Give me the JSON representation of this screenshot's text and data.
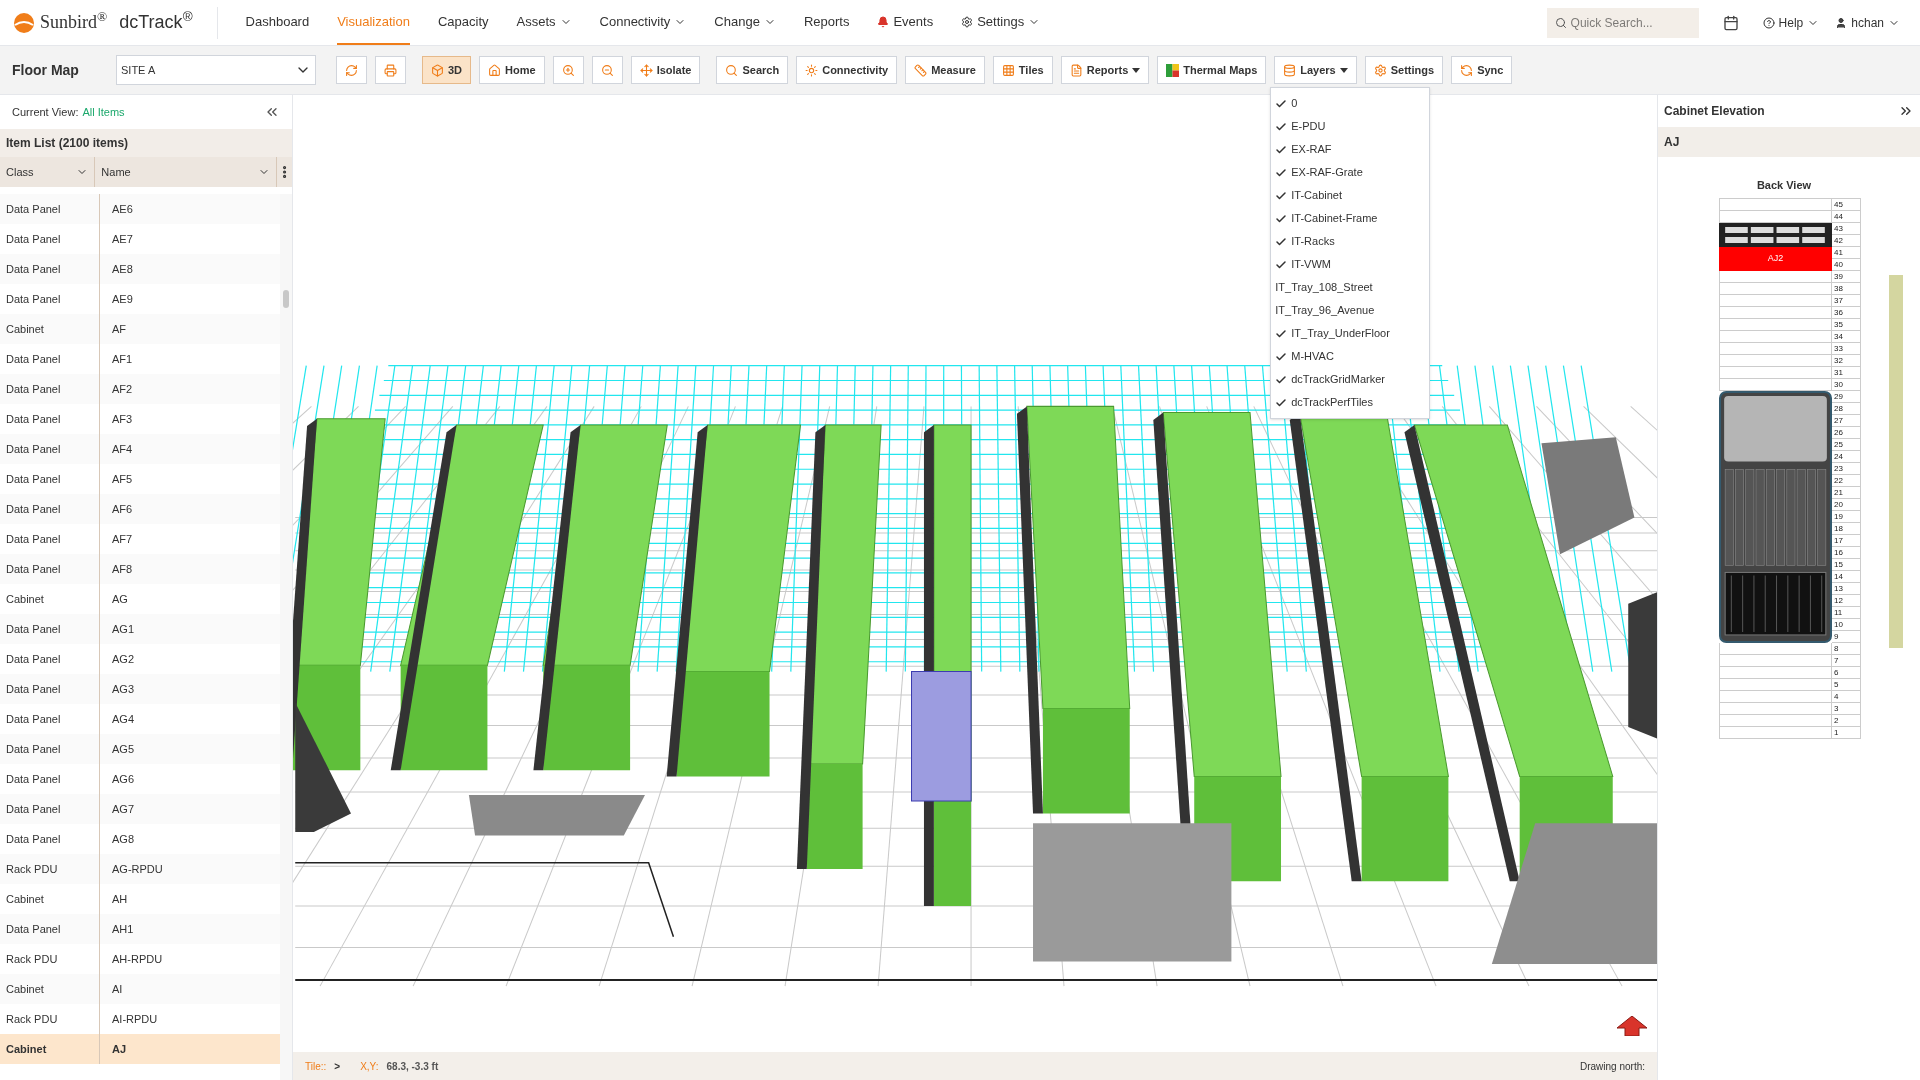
{
  "header": {
    "brand": "Sunbird$^{®}$",
    "product": "dcTrack$^{®}$",
    "nav": [
      {
        "label": "Dashboard",
        "selected": false,
        "dropdown": false
      },
      {
        "label": "Visualization",
        "selected": true,
        "dropdown": false
      },
      {
        "label": "Capacity",
        "selected": false,
        "dropdown": false
      },
      {
        "label": "Assets",
        "selected": false,
        "dropdown": true
      },
      {
        "label": "Connectivity",
        "selected": false,
        "dropdown": true
      },
      {
        "label": "Change",
        "selected": false,
        "dropdown": true
      },
      {
        "label": "Reports",
        "selected": false,
        "dropdown": false
      },
      {
        "label": "Events",
        "selected": false,
        "dropdown": false
      },
      {
        "label": "Settings",
        "selected": false,
        "dropdown": true
      }
    ],
    "search": {
      "placeholder": "Quick Search..."
    },
    "help": "Help",
    "user": "hchan"
  },
  "toolbar": {
    "title": "Floor Map",
    "site": {
      "value": "SITE A"
    },
    "buttons": [
      {
        "selected": false,
        "dropdown": false
      },
      {
        "selected": false,
        "dropdown": false
      },
      {
        "label": "3D",
        "selected": true,
        "dropdown": false
      },
      {
        "label": "Home",
        "selected": false,
        "dropdown": false
      },
      {
        "selected": false,
        "dropdown": false
      },
      {
        "selected": false,
        "dropdown": false
      },
      {
        "label": "Isolate",
        "selected": false,
        "dropdown": false
      },
      {
        "label": "Search",
        "selected": false,
        "dropdown": false
      },
      {
        "label": "Connectivity",
        "selected": false,
        "dropdown": false
      },
      {
        "label": "Measure",
        "selected": false,
        "dropdown": false
      },
      {
        "label": "Tiles",
        "selected": false,
        "dropdown": false
      },
      {
        "label": "Reports",
        "selected": false,
        "dropdown": true
      },
      {
        "label": "Thermal Maps",
        "selected": false,
        "dropdown": false
      },
      {
        "label": "Layers",
        "selected": false,
        "dropdown": true
      },
      {
        "label": "Settings",
        "selected": false,
        "dropdown": false
      },
      {
        "label": "Sync",
        "selected": false,
        "dropdown": false
      }
    ]
  },
  "layers_menu": {
    "expanded": true,
    "items": [
      {
        "label": "0",
        "checked": true
      },
      {
        "label": "E-PDU",
        "checked": true
      },
      {
        "label": "EX-RAF",
        "checked": true
      },
      {
        "label": "EX-RAF-Grate",
        "checked": true
      },
      {
        "label": "IT-Cabinet",
        "checked": true
      },
      {
        "label": "IT-Cabinet-Frame",
        "checked": true
      },
      {
        "label": "IT-Racks",
        "checked": true
      },
      {
        "label": "IT-VWM",
        "checked": true
      },
      {
        "label": "IT_Tray_108_Street",
        "checked": false
      },
      {
        "label": "IT_Tray_96_Avenue",
        "checked": false
      },
      {
        "label": "IT_Tray_UnderFloor",
        "checked": true
      },
      {
        "label": "M-HVAC",
        "checked": true
      },
      {
        "label": "dcTrackGridMarker",
        "checked": true
      },
      {
        "label": "dcTrackPerfTiles",
        "checked": true
      }
    ]
  },
  "left_panel": {
    "current_view_label": "Current View:",
    "current_view": "All Items",
    "list_title": "Item List (2100 items)",
    "columns": [
      "Class",
      "Name"
    ],
    "rows": [
      {
        "class": "Data Panel",
        "name": "AE6",
        "selected": false
      },
      {
        "class": "Data Panel",
        "name": "AE7",
        "selected": false
      },
      {
        "class": "Data Panel",
        "name": "AE8",
        "selected": false
      },
      {
        "class": "Data Panel",
        "name": "AE9",
        "selected": false
      },
      {
        "class": "Cabinet",
        "name": "AF",
        "selected": false
      },
      {
        "class": "Data Panel",
        "name": "AF1",
        "selected": false
      },
      {
        "class": "Data Panel",
        "name": "AF2",
        "selected": false
      },
      {
        "class": "Data Panel",
        "name": "AF3",
        "selected": false
      },
      {
        "class": "Data Panel",
        "name": "AF4",
        "selected": false
      },
      {
        "class": "Data Panel",
        "name": "AF5",
        "selected": false
      },
      {
        "class": "Data Panel",
        "name": "AF6",
        "selected": false
      },
      {
        "class": "Data Panel",
        "name": "AF7",
        "selected": false
      },
      {
        "class": "Data Panel",
        "name": "AF8",
        "selected": false
      },
      {
        "class": "Cabinet",
        "name": "AG",
        "selected": false
      },
      {
        "class": "Data Panel",
        "name": "AG1",
        "selected": false
      },
      {
        "class": "Data Panel",
        "name": "AG2",
        "selected": false
      },
      {
        "class": "Data Panel",
        "name": "AG3",
        "selected": false
      },
      {
        "class": "Data Panel",
        "name": "AG4",
        "selected": false
      },
      {
        "class": "Data Panel",
        "name": "AG5",
        "selected": false
      },
      {
        "class": "Data Panel",
        "name": "AG6",
        "selected": false
      },
      {
        "class": "Data Panel",
        "name": "AG7",
        "selected": false
      },
      {
        "class": "Data Panel",
        "name": "AG8",
        "selected": false
      },
      {
        "class": "Rack PDU",
        "name": "AG-RPDU",
        "selected": false
      },
      {
        "class": "Cabinet",
        "name": "AH",
        "selected": false
      },
      {
        "class": "Data Panel",
        "name": "AH1",
        "selected": false
      },
      {
        "class": "Rack PDU",
        "name": "AH-RPDU",
        "selected": false
      },
      {
        "class": "Cabinet",
        "name": "AI",
        "selected": false
      },
      {
        "class": "Rack PDU",
        "name": "AI-RPDU",
        "selected": false
      },
      {
        "class": "Cabinet",
        "name": "AJ",
        "selected": true
      }
    ]
  },
  "status_bar": {
    "tile_label": "Tile::",
    "tile_value": ">",
    "xy_label": "X,Y:",
    "xy_value": "68.3, -3.3 ft",
    "north_label": "Drawing north:"
  },
  "right_panel": {
    "title": "Cabinet Elevation",
    "cabinet": "AJ",
    "view": "Back View",
    "slots": [
      {
        "kind": "empty",
        "units": [
          "45"
        ]
      },
      {
        "kind": "empty",
        "units": [
          "44"
        ]
      },
      {
        "kind": "patch-panel",
        "units": [
          "43",
          "42"
        ]
      },
      {
        "kind": "server",
        "label": "AJ2",
        "units": [
          "41",
          "40"
        ]
      },
      {
        "kind": "empty",
        "units": [
          "39"
        ]
      },
      {
        "kind": "empty",
        "units": [
          "38"
        ]
      },
      {
        "kind": "empty",
        "units": [
          "37"
        ]
      },
      {
        "kind": "empty",
        "units": [
          "36"
        ]
      },
      {
        "kind": "empty",
        "units": [
          "35"
        ]
      },
      {
        "kind": "empty",
        "units": [
          "34"
        ]
      },
      {
        "kind": "empty",
        "units": [
          "33"
        ]
      },
      {
        "kind": "empty",
        "units": [
          "32"
        ]
      },
      {
        "kind": "empty",
        "units": [
          "31"
        ]
      },
      {
        "kind": "empty",
        "units": [
          "30"
        ]
      },
      {
        "kind": "chassis",
        "units": [
          "29",
          "28",
          "27",
          "26",
          "25",
          "24",
          "23",
          "22",
          "21",
          "20",
          "19",
          "18",
          "17",
          "16",
          "15",
          "14",
          "13",
          "12",
          "11",
          "10",
          "9"
        ]
      },
      {
        "kind": "empty",
        "units": [
          "8"
        ]
      },
      {
        "kind": "empty",
        "units": [
          "7"
        ]
      },
      {
        "kind": "empty",
        "units": [
          "6"
        ]
      },
      {
        "kind": "empty",
        "units": [
          "5"
        ]
      },
      {
        "kind": "empty",
        "units": [
          "4"
        ]
      },
      {
        "kind": "empty",
        "units": [
          "3"
        ]
      },
      {
        "kind": "empty",
        "units": [
          "2"
        ]
      },
      {
        "kind": "empty",
        "units": [
          "1"
        ]
      }
    ]
  }
}
